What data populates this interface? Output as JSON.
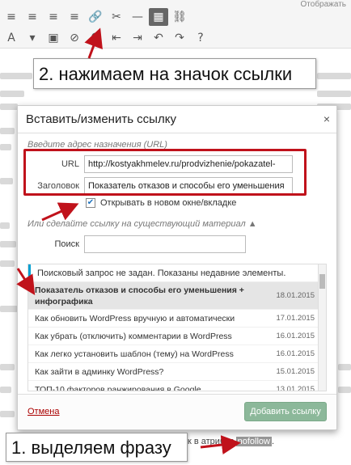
{
  "header": {
    "top_right_fragment": "Отображать"
  },
  "toolbar": {
    "row1": [
      "≡",
      "≡",
      "≡",
      "≡",
      "🔗",
      "✂",
      "—",
      "▦",
      "⛓"
    ],
    "row2": [
      "A",
      "▾",
      "▣",
      "⊘",
      "Ω",
      "⇤",
      "⇥",
      "↶",
      "↷",
      "?"
    ],
    "icons_row1": [
      "align-left-icon",
      "align-center-icon",
      "align-right-icon",
      "align-justify-icon",
      "link-icon",
      "unlink-icon",
      "more-tag-icon",
      "keyboard-icon",
      "chain-icon"
    ],
    "icons_row2": [
      "text-color-icon",
      "dropdown-icon",
      "paste-text-icon",
      "clear-format-icon",
      "omega-icon",
      "outdent-icon",
      "indent-icon",
      "undo-icon",
      "redo-icon",
      "help-icon"
    ]
  },
  "callouts": {
    "step2": "2. нажимаем на значок ссылки",
    "step1": "1. выделяем фразу"
  },
  "dialog": {
    "title": "Вставить/изменить ссылку",
    "close_label": "×",
    "target_section_label": "Введите адрес назначения (URL)",
    "url_label": "URL",
    "url_value": "http://kostyakhmelev.ru/prodvizhenie/pokazatel-",
    "title_label": "Заголовок",
    "title_value": "Показатель отказов и способы его уменьшения",
    "new_window_label": "Открывать в новом окне/вкладке",
    "new_window_checked": "✔",
    "existing_section_label": "Или сделайте ссылку на существующий материал ▲",
    "search_label": "Поиск",
    "notice": "Поисковый запрос не задан. Показаны недавние элементы.",
    "results": [
      {
        "title": "Показатель отказов и способы его уменьшения + инфографика",
        "date": "18.01.2015"
      },
      {
        "title": "Как обновить WordPress вручную и автоматически",
        "date": "17.01.2015"
      },
      {
        "title": "Как убрать (отключить) комментарии в WordPress",
        "date": "16.01.2015"
      },
      {
        "title": "Как легко установить шаблон (тему) на WordPress",
        "date": "16.01.2015"
      },
      {
        "title": "Как зайти в админку WordPress?",
        "date": "15.01.2015"
      },
      {
        "title": "ТОП-10 факторов ранжирования в Google",
        "date": "13.01.2015"
      }
    ],
    "cancel_label": "Отмена",
    "add_label": "Добавить ссылку"
  },
  "bottom_strip": {
    "prefix": "к в атрибут ",
    "highlight": "nofollow",
    "suffix": "."
  },
  "colors": {
    "annotation_red": "#c0121b",
    "notice_accent": "#00a0d2",
    "add_button_bg": "#8cb89a"
  }
}
